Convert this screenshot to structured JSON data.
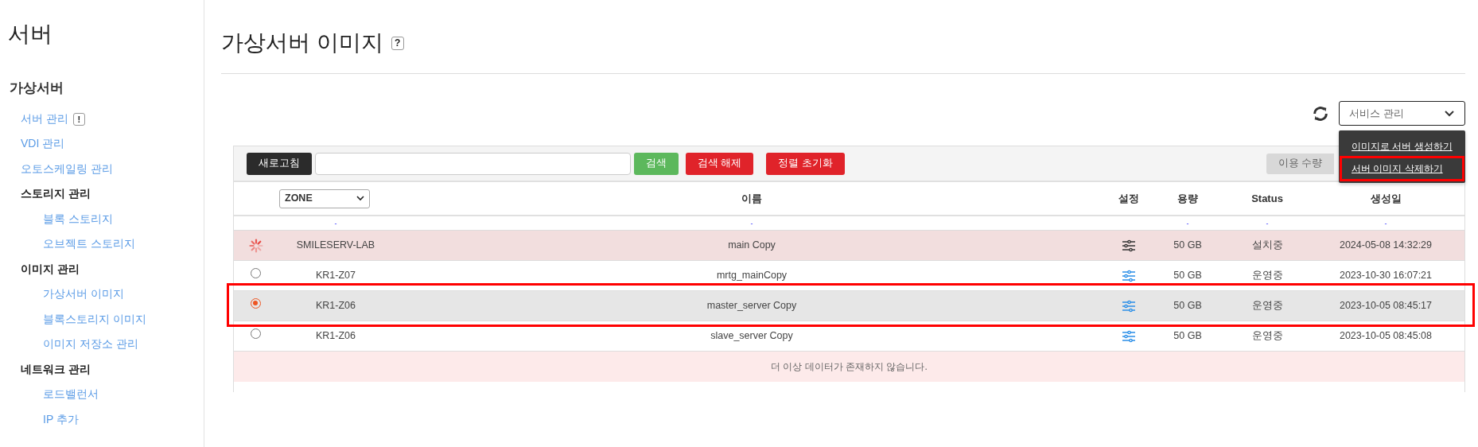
{
  "sidebar": {
    "title": "서버",
    "groups": [
      {
        "label": "가상서버",
        "items": [
          {
            "label": "서버 관리",
            "badge": "!"
          },
          {
            "label": "VDI 관리"
          },
          {
            "label": "오토스케일링 관리"
          },
          {
            "label": "스토리지 관리",
            "children": [
              {
                "label": "블록 스토리지"
              },
              {
                "label": "오브젝트 스토리지"
              }
            ]
          },
          {
            "label": "이미지 관리",
            "children": [
              {
                "label": "가상서버 이미지"
              },
              {
                "label": "블록스토리지 이미지"
              },
              {
                "label": "이미지 저장소 관리"
              }
            ]
          },
          {
            "label": "네트워크 관리",
            "children": [
              {
                "label": "로드밸런서"
              },
              {
                "label": "IP 추가"
              }
            ]
          }
        ]
      }
    ]
  },
  "page": {
    "title": "가상서버 이미지",
    "help": "?"
  },
  "service_menu": {
    "label": "서비스 관리",
    "expanded": true,
    "items": [
      {
        "label": "이미지로 서버 생성하기",
        "highlighted": false
      },
      {
        "label": "서버 이미지 삭제하기",
        "highlighted": true
      }
    ]
  },
  "toolbar": {
    "buttons": [
      {
        "label": "새로고침",
        "kind": "dark"
      }
    ],
    "search_buttons": [
      {
        "label": "검색",
        "kind": "success"
      },
      {
        "label": "검색 해제",
        "kind": "danger"
      },
      {
        "label": "정렬 초기화",
        "kind": "danger"
      }
    ],
    "usage_button": "이용 수량"
  },
  "table": {
    "columns": [
      {
        "kind": "blank"
      },
      {
        "kind": "select",
        "label": "ZONE",
        "filter": "-"
      },
      {
        "kind": "text",
        "label": "이름",
        "filter": "-"
      },
      {
        "kind": "text",
        "label": "설정"
      },
      {
        "kind": "text",
        "label": "용량",
        "filter": "-"
      },
      {
        "kind": "text",
        "label": "Status",
        "filter": "-"
      },
      {
        "kind": "text",
        "label": "생성일",
        "filter": "-"
      }
    ],
    "rows": [
      {
        "kind": "installing",
        "selected": false,
        "highlighted": false,
        "zone": "SMILESERV-LAB",
        "name": "main Copy",
        "size": "50 GB",
        "status": "설치중",
        "created": "2024-05-08 14:32:29"
      },
      {
        "kind": "radio",
        "selected": false,
        "highlighted": false,
        "zone": "KR1-Z07",
        "name": "mrtg_mainCopy",
        "size": "50 GB",
        "status": "운영중",
        "created": "2023-10-30 16:07:21"
      },
      {
        "kind": "radio",
        "selected": true,
        "highlighted": true,
        "zone": "KR1-Z06",
        "name": "master_server Copy",
        "size": "50 GB",
        "status": "운영중",
        "created": "2023-10-05 08:45:17"
      },
      {
        "kind": "radio",
        "selected": false,
        "highlighted": false,
        "zone": "KR1-Z06",
        "name": "slave_server Copy",
        "size": "50 GB",
        "status": "운영중",
        "created": "2023-10-05 08:45:08"
      }
    ],
    "empty_message": "더 이상 데이터가 존재하지 않습니다."
  }
}
